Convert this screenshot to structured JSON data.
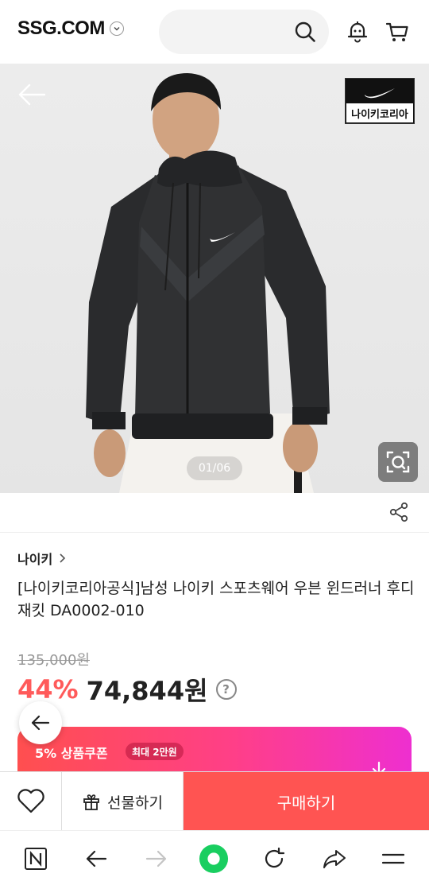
{
  "header": {
    "logo": "SSG.COM",
    "icons": [
      "chevron-down-icon",
      "search-icon",
      "bell-icon",
      "cart-icon"
    ]
  },
  "hero": {
    "brand_badge": "나이키코리아",
    "image_counter": "01/06",
    "icons": [
      "back-arrow-icon",
      "lens-search-icon"
    ]
  },
  "product": {
    "brand": "나이키",
    "title": "[나이키코리아공식]남성 나이키 스포츠웨어 우븐 윈드러너 후디 재킷 DA0002-010",
    "original_price": "135,000원",
    "discount": "44%",
    "price": "74,844원",
    "help": "?"
  },
  "coupon": {
    "label": "5% 상품쿠폰",
    "badge": "최대 2만원"
  },
  "buy_bar": {
    "gift": "선물하기",
    "buy": "구매하기"
  },
  "browser_nav": {
    "icons": [
      "naver-n-icon",
      "back-icon",
      "forward-icon",
      "home-dot-icon",
      "refresh-icon",
      "share-icon",
      "menu-icon"
    ]
  },
  "colors": {
    "accent_red": "#ff5452",
    "discount_red": "#ff5a5a",
    "coupon_gradient": [
      "#ff4f4f",
      "#ff3f88",
      "#ee2fd0"
    ],
    "naver_green": "#19ce60"
  }
}
